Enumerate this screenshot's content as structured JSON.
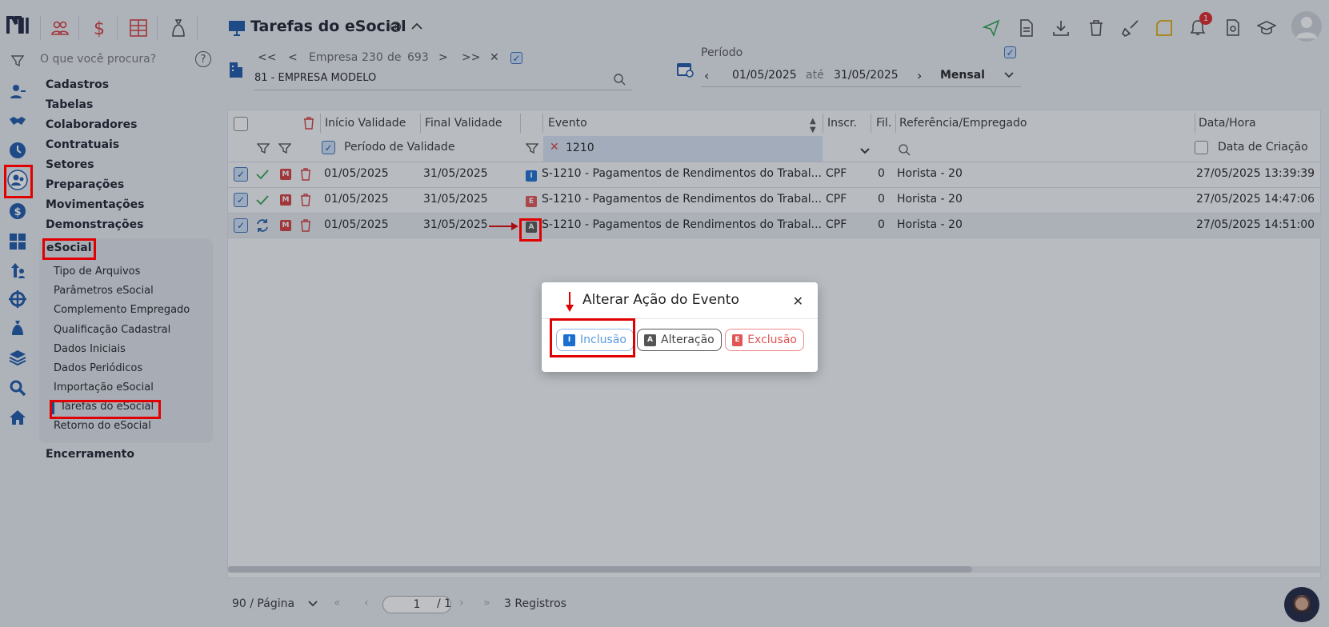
{
  "app": {
    "search_placeholder": "O que você procura?",
    "page_title": "Tarefas do eSocial"
  },
  "menu": {
    "sections": [
      "Cadastros",
      "Tabelas",
      "Colaboradores",
      "Contratuais",
      "Setores",
      "Preparações",
      "Movimentações",
      "Demonstrações",
      "eSocial"
    ],
    "esocial_items": [
      "Tipo de Arquivos",
      "Parâmetros eSocial",
      "Complemento Empregado",
      "Qualificação Cadastral",
      "Dados Iniciais",
      "Dados Periódicos",
      "Importação eSocial",
      "Tarefas do eSocial",
      "Retorno do eSocial"
    ],
    "last_section": "Encerramento"
  },
  "company_nav": {
    "first": "<<",
    "prev": "<",
    "label": "Empresa",
    "current": "230",
    "of": "de",
    "total": "693",
    "next": ">",
    "last": ">>",
    "clear": "✕",
    "selected": "81 - EMPRESA MODELO"
  },
  "period": {
    "label": "Período",
    "start": "01/05/2025",
    "until": "até",
    "end": "31/05/2025",
    "mode": "Mensal"
  },
  "grid": {
    "headers": {
      "inicio": "Início Validade",
      "final": "Final Validade",
      "evento": "Evento",
      "inscr": "Inscr.",
      "fil": "Fil.",
      "ref": "Referência/Empregado",
      "datahora": "Data/Hora"
    },
    "filters": {
      "periodo": "Período de Validade",
      "evento": "1210",
      "data_criacao": "Data de Criação"
    },
    "rows": [
      {
        "status": "check",
        "badge": "I",
        "inicio": "01/05/2025",
        "final": "31/05/2025",
        "evento": "S-1210 - Pagamentos de Rendimentos do Trabal...",
        "inscr": "CPF",
        "fil": "0",
        "ref": "Horista - 20",
        "datahora": "27/05/2025 13:39:39"
      },
      {
        "status": "check",
        "badge": "E",
        "inicio": "01/05/2025",
        "final": "31/05/2025",
        "evento": "S-1210 - Pagamentos de Rendimentos do Trabal...",
        "inscr": "CPF",
        "fil": "0",
        "ref": "Horista - 20",
        "datahora": "27/05/2025 14:47:06"
      },
      {
        "status": "sync",
        "badge": "A",
        "inicio": "01/05/2025",
        "final": "31/05/2025",
        "evento": "S-1210 - Pagamentos de Rendimentos do Trabal...",
        "inscr": "CPF",
        "fil": "0",
        "ref": "Horista - 20",
        "datahora": "27/05/2025 14:51:00"
      }
    ],
    "m_label": "M"
  },
  "footer": {
    "page_size": "90 / Página",
    "page": "1",
    "pages": "/ 1",
    "records": "3 Registros"
  },
  "modal": {
    "title": "Alterar Ação do Evento",
    "close": "✕",
    "btn_inclusao_badge": "I",
    "btn_inclusao": "Inclusão",
    "btn_alteracao_badge": "A",
    "btn_alteracao": "Alteração",
    "btn_exclusao_badge": "E",
    "btn_exclusao": "Exclusão"
  },
  "notifications": {
    "count": "1"
  },
  "colors": {
    "accent": "#1a56a8",
    "danger": "#d63b3b",
    "success": "#2aa24a",
    "badge_i": "#1a6fd1",
    "badge_e": "#e25555",
    "badge_a": "#555555"
  }
}
